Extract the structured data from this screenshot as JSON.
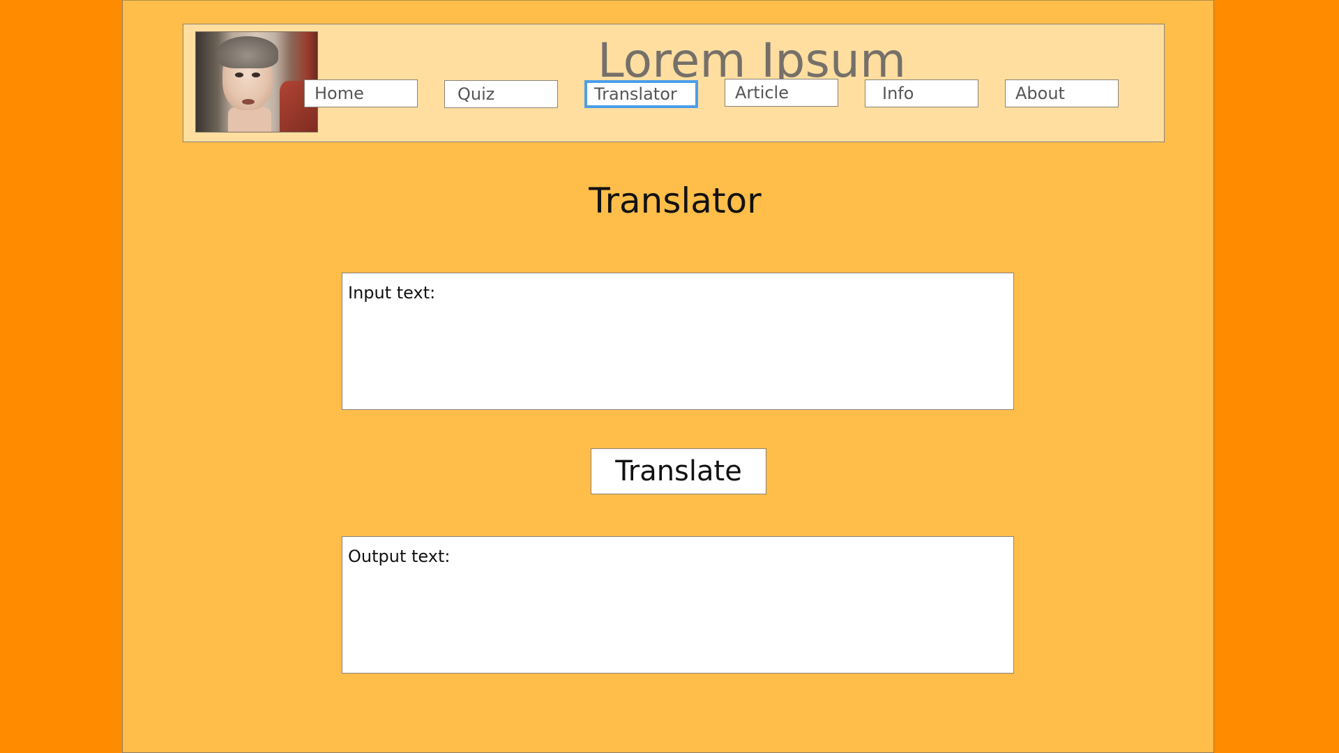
{
  "header": {
    "site_title": "Lorem Ipsum",
    "nav": [
      {
        "label": "Home",
        "active": false
      },
      {
        "label": "Quiz",
        "active": false
      },
      {
        "label": "Translator",
        "active": true
      },
      {
        "label": "Article",
        "active": false
      },
      {
        "label": "Info",
        "active": false
      },
      {
        "label": "About",
        "active": false
      }
    ]
  },
  "main": {
    "title": "Translator",
    "input_placeholder": "Input text:",
    "translate_label": "Translate",
    "output_placeholder": "Output text:"
  },
  "colors": {
    "outer_background": "#ff8c00",
    "page_background": "#ffbd4a",
    "header_background": "#ffdea0",
    "active_nav_border": "#4a9eea"
  }
}
